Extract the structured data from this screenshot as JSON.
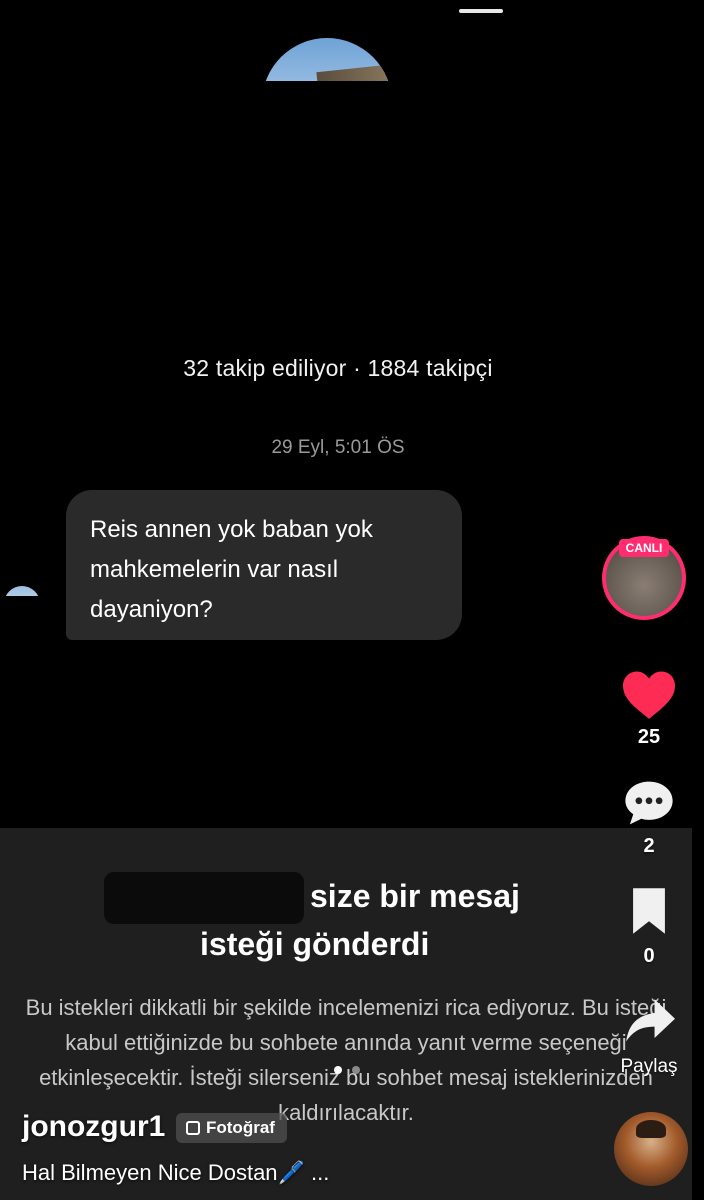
{
  "profile": {
    "follow_stats": "32 takip ediliyor · 1884 takipçi"
  },
  "chat": {
    "timestamp": "29 Eyl, 5:01 ÖS",
    "message": "Reis annen yok baban yok mahkemelerin var nasıl dayaniyon?"
  },
  "request_sheet": {
    "title_line1": "size bir mesaj",
    "title_line2": "isteği gönderdi",
    "body": "Bu istekleri dikkatli bir şekilde incelemenizi rica ediyoruz. Bu isteği kabul ettiğinizde bu sohbete anında yanıt verme seçeneği etkinleşecektir. İsteği silerseniz bu sohbet mesaj isteklerinizden kaldırılacaktır."
  },
  "rail": {
    "live_label": "CANLI",
    "likes": "25",
    "comments": "2",
    "saves": "0",
    "share_label": "Paylaş",
    "like_color": "#fe2c55"
  },
  "post": {
    "username": "jonozgur1",
    "type_badge": "Fotoğraf",
    "caption": "Hal Bilmeyen Nice Dostan🖊️ ..."
  },
  "carousel": {
    "total": 2,
    "current": 1
  }
}
